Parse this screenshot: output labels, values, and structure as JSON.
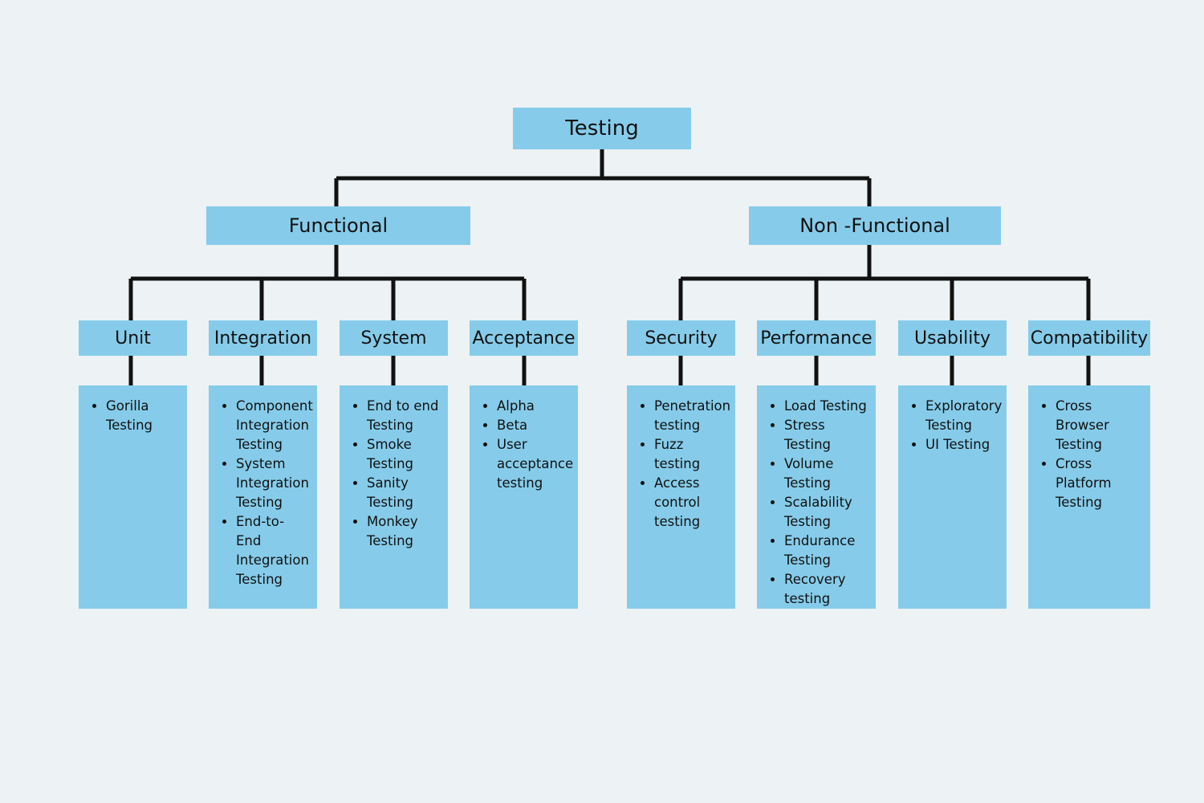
{
  "diagram": {
    "title": "Testing",
    "background_color": "#edf2f4",
    "node_color": "#86ccea",
    "connector_color": "#111111",
    "root": {
      "label": "Testing"
    },
    "level2": [
      {
        "label": "Functional"
      },
      {
        "label": "Non -Functional"
      }
    ],
    "level3": [
      {
        "label": "Unit"
      },
      {
        "label": "Integration"
      },
      {
        "label": "System"
      },
      {
        "label": "Acceptance"
      },
      {
        "label": "Security"
      },
      {
        "label": "Performance"
      },
      {
        "label": "Usability"
      },
      {
        "label": "Compatibility"
      }
    ],
    "panels": [
      {
        "parent": "Unit",
        "items": [
          "Gorilla Testing"
        ]
      },
      {
        "parent": "Integration",
        "items": [
          "Component Integration Testing",
          "System Integration Testing",
          "End-to-End Integration Testing"
        ]
      },
      {
        "parent": "System",
        "items": [
          "End to end Testing",
          "Smoke Testing",
          "Sanity Testing",
          "Monkey Testing"
        ]
      },
      {
        "parent": "Acceptance",
        "items": [
          "Alpha",
          "Beta",
          "User acceptance testing"
        ]
      },
      {
        "parent": "Security",
        "items": [
          "Penetration testing",
          "Fuzz testing",
          "Access control testing"
        ]
      },
      {
        "parent": "Performance",
        "items": [
          "Load Testing",
          "Stress Testing",
          "Volume Testing",
          "Scalability Testing",
          "Endurance Testing",
          "Recovery testing"
        ]
      },
      {
        "parent": "Usability",
        "items": [
          "Exploratory Testing",
          "UI Testing"
        ]
      },
      {
        "parent": "Compatibility",
        "items": [
          "Cross Browser Testing",
          "Cross Platform Testing"
        ]
      }
    ]
  }
}
